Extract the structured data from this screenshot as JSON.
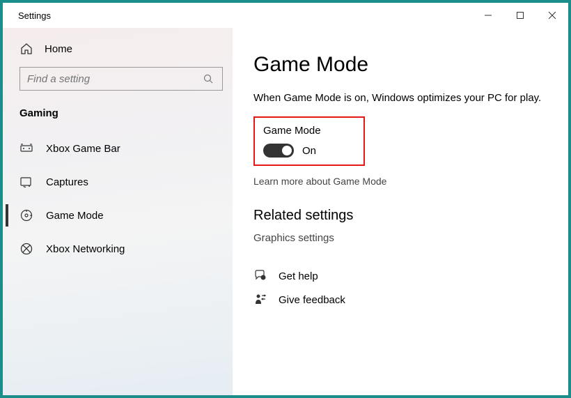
{
  "titlebar": {
    "title": "Settings"
  },
  "sidebar": {
    "home": "Home",
    "search_placeholder": "Find a setting",
    "section": "Gaming",
    "items": [
      {
        "label": "Xbox Game Bar"
      },
      {
        "label": "Captures"
      },
      {
        "label": "Game Mode"
      },
      {
        "label": "Xbox Networking"
      }
    ]
  },
  "main": {
    "title": "Game Mode",
    "description": "When Game Mode is on, Windows optimizes your PC for play.",
    "toggle": {
      "label": "Game Mode",
      "state": "On"
    },
    "learn_more": "Learn more about Game Mode",
    "related": {
      "title": "Related settings",
      "graphics": "Graphics settings"
    },
    "help": {
      "get_help": "Get help",
      "feedback": "Give feedback"
    }
  }
}
